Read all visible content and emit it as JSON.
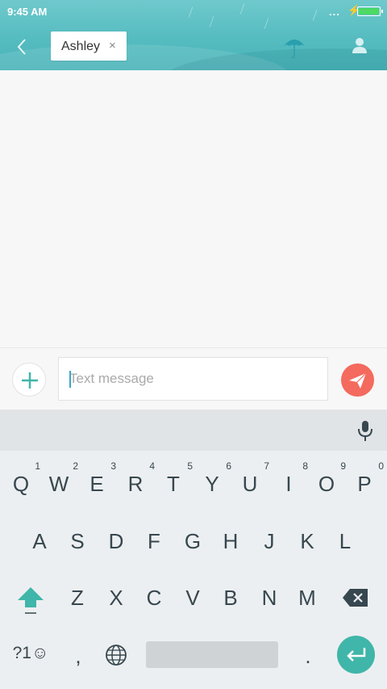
{
  "status_bar": {
    "time": "9:45 AM",
    "dots": "...",
    "bolt": "⚡"
  },
  "header": {
    "recipient": "Ashley",
    "remove_glyph": "×"
  },
  "composer": {
    "placeholder": "Text message"
  },
  "keyboard": {
    "row1": [
      {
        "label": "Q",
        "num": "1"
      },
      {
        "label": "W",
        "num": "2"
      },
      {
        "label": "E",
        "num": "3"
      },
      {
        "label": "R",
        "num": "4"
      },
      {
        "label": "T",
        "num": "5"
      },
      {
        "label": "Y",
        "num": "6"
      },
      {
        "label": "U",
        "num": "7"
      },
      {
        "label": "I",
        "num": "8"
      },
      {
        "label": "O",
        "num": "9"
      },
      {
        "label": "P",
        "num": "0"
      }
    ],
    "row2": [
      "A",
      "S",
      "D",
      "F",
      "G",
      "H",
      "J",
      "K",
      "L"
    ],
    "row3": [
      "Z",
      "X",
      "C",
      "V",
      "B",
      "N",
      "M"
    ],
    "symbols_label": "?1☺",
    "comma": ",",
    "period": "."
  },
  "colors": {
    "accent": "#55bcc0",
    "send": "#f46a5e",
    "enter": "#3fb6a9",
    "keytext": "#37474f"
  }
}
